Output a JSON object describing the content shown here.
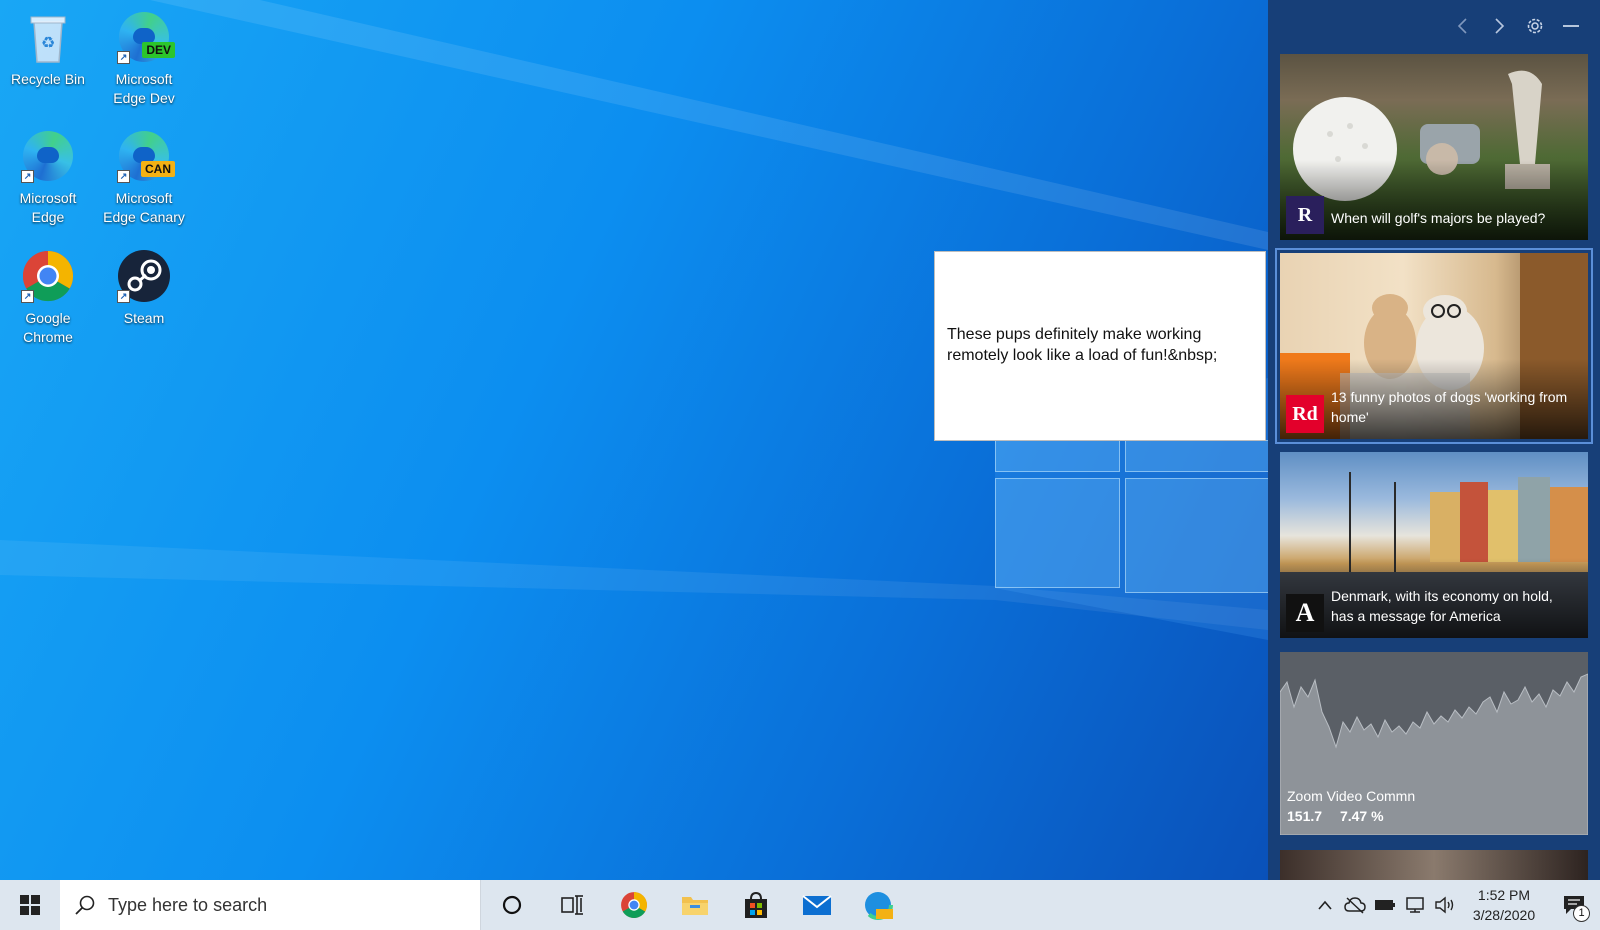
{
  "desktop": {
    "icons": [
      {
        "label": "Recycle Bin",
        "icon": "recycle-bin-icon"
      },
      {
        "label": "Microsoft Edge Dev",
        "icon": "edge-dev-icon",
        "tag": "DEV"
      },
      {
        "label": "Microsoft Edge",
        "icon": "edge-icon"
      },
      {
        "label": "Microsoft Edge Canary",
        "icon": "edge-canary-icon",
        "tag": "CAN"
      },
      {
        "label": "Google Chrome",
        "icon": "chrome-icon"
      },
      {
        "label": "Steam",
        "icon": "steam-icon"
      }
    ]
  },
  "tooltip": {
    "text": "These pups definitely make working remotely look like a load of fun!&nbsp;"
  },
  "news_panel": {
    "controls": [
      "chevron-left-icon",
      "chevron-right-icon",
      "gear-icon",
      "minimize-icon"
    ],
    "cards": [
      {
        "source_logo": "R",
        "headline": "When will golf's majors be played?",
        "logo_color": "#2a1f5c"
      },
      {
        "source_logo": "Rd",
        "headline": "13 funny photos of dogs 'working from home'",
        "logo_color": "#e3002b"
      },
      {
        "source_logo": "A",
        "headline": "Denmark, with its economy on hold, has a message for America",
        "logo_color": "#111111"
      }
    ],
    "stock": {
      "name": "Zoom Video Commn",
      "price": "151.7",
      "change": "7.47 %"
    }
  },
  "taskbar": {
    "search_placeholder": "Type here to search",
    "pinned": [
      "cortana-icon",
      "task-view-icon",
      "chrome-icon",
      "file-explorer-icon",
      "store-icon",
      "mail-icon",
      "edge-canary-icon"
    ],
    "clock": {
      "time": "1:52 PM",
      "date": "3/28/2020"
    },
    "notification_count": "1"
  }
}
